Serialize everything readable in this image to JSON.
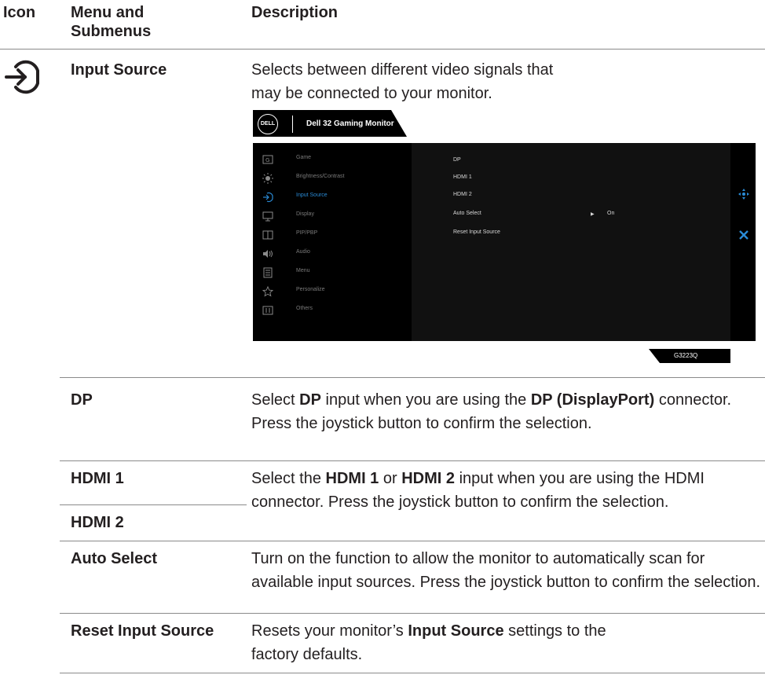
{
  "header": {
    "icon": "Icon",
    "menu": "Menu and Submenus",
    "description": "Description"
  },
  "input_source": {
    "icon": "input-source-icon",
    "name": "Input Source",
    "description": "Selects between different video signals that may be connected to your monitor."
  },
  "osd": {
    "logo": "DELL",
    "title": "Dell 32 Gaming Monitor",
    "model": "G3223Q",
    "accent_color": "#2a8bd6",
    "menu_items": [
      {
        "label": "Game",
        "icon": "game-icon"
      },
      {
        "label": "Brightness/Contrast",
        "icon": "brightness-icon"
      },
      {
        "label": "Input Source",
        "icon": "input-source-icon"
      },
      {
        "label": "Display",
        "icon": "display-icon"
      },
      {
        "label": "PIP/PBP",
        "icon": "pip-pbp-icon"
      },
      {
        "label": "Audio",
        "icon": "audio-icon"
      },
      {
        "label": "Menu",
        "icon": "menu-icon"
      },
      {
        "label": "Personalize",
        "icon": "star-icon"
      },
      {
        "label": "Others",
        "icon": "others-icon"
      }
    ],
    "selected_item": "Input Source",
    "options": [
      "DP",
      "HDMI 1",
      "HDMI 2",
      "Auto Select",
      "Reset Input Source"
    ],
    "auto_select_value": "On"
  },
  "rows": {
    "dp": {
      "name": "DP",
      "desc_1": "Select ",
      "desc_b1": "DP",
      "desc_2": " input when you are using the ",
      "desc_b2": "DP (DisplayPort)",
      "desc_3": " connector. Press the joystick button to confirm the selection."
    },
    "hdmi": {
      "name_1": "HDMI 1",
      "name_2": "HDMI 2",
      "desc_1": "Select the ",
      "desc_b1": "HDMI 1",
      "desc_2": " or ",
      "desc_b2": "HDMI 2",
      "desc_3": " input when you are using the HDMI connector. Press the joystick button to confirm the selection."
    },
    "auto_select": {
      "name": "Auto Select",
      "description": "Turn on the function to allow the monitor to automatically scan for available input sources. Press the joystick button to confirm the selection."
    },
    "reset": {
      "name": "Reset Input Source",
      "desc_1": "Resets your monitor’s ",
      "desc_b1": "Input Source",
      "desc_2": " settings to the factory defaults."
    }
  }
}
